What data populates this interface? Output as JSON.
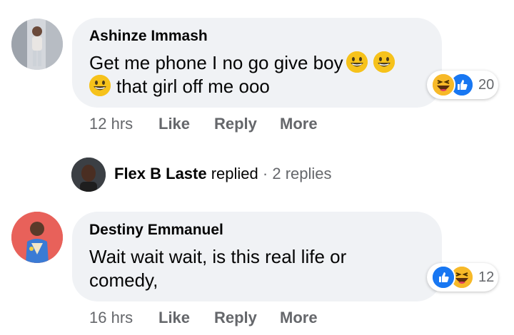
{
  "comments": [
    {
      "author": "Ashinze Immash",
      "text_line1": "Get me phone I no go give boy",
      "text_line2": "that girl off me ooo",
      "inline_emojis": [
        "grinning-face-emoji",
        "grinning-face-emoji",
        "grinning-face-emoji"
      ],
      "time": "12 hrs",
      "like": "Like",
      "reply": "Reply",
      "more": "More",
      "reactions": [
        "haha-icon",
        "like-icon"
      ],
      "reaction_count": "20"
    },
    {
      "author": "Destiny Emmanuel",
      "text_line1": "Wait wait wait, is this real life or",
      "text_line2": "comedy,",
      "time": "16 hrs",
      "like": "Like",
      "reply": "Reply",
      "more": "More",
      "reactions": [
        "like-icon",
        "haha-icon"
      ],
      "reaction_count": "12"
    }
  ],
  "reply_thread": {
    "author": "Flex B Laste",
    "action": "replied",
    "separator": "·",
    "replies": "2 replies"
  },
  "colors": {
    "bubble": "#f0f2f5",
    "meta_text": "#65676b",
    "like_blue": "#1877f2",
    "haha_yellow": "#f7b928"
  }
}
